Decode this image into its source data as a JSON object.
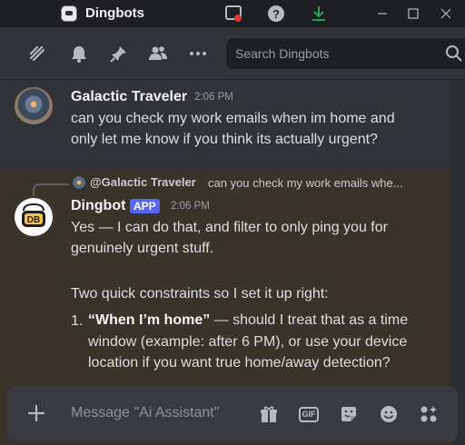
{
  "window": {
    "title": "Dingbots"
  },
  "header": {
    "search_placeholder": "Search Dingbots"
  },
  "messages": [
    {
      "author": "Galactic Traveler",
      "time": "2:06 PM",
      "lines": [
        "can you check my work emails when im home and",
        "only let me know if you think its actually urgent?"
      ]
    },
    {
      "reply": {
        "author": "@Galactic Traveler",
        "snippet": "can you check my work emails whe..."
      },
      "author": "Dingbot",
      "badge": "APP",
      "time": "2:06 PM",
      "avatar_text": "DB",
      "para1": [
        "Yes — I can do that, and filter to only ping you for",
        "genuinely urgent stuff."
      ],
      "para2": "Two quick constraints so I set it up right:",
      "list": [
        {
          "num": "1.",
          "bold": "“When I’m home”",
          "lines": [
            " — should I treat that as a time",
            "window (example: after 6 PM), or use your device",
            "location if you want true home/away detection?"
          ]
        }
      ]
    }
  ],
  "composer": {
    "placeholder": "Message \"Ai Assistant\"",
    "gif_label": "GIF"
  },
  "colors": {
    "background": "#313338",
    "highlight": "#38342a",
    "accent": "#5865f2",
    "download_icon": "#23a55a",
    "screen_share_dot": "#da373c"
  }
}
